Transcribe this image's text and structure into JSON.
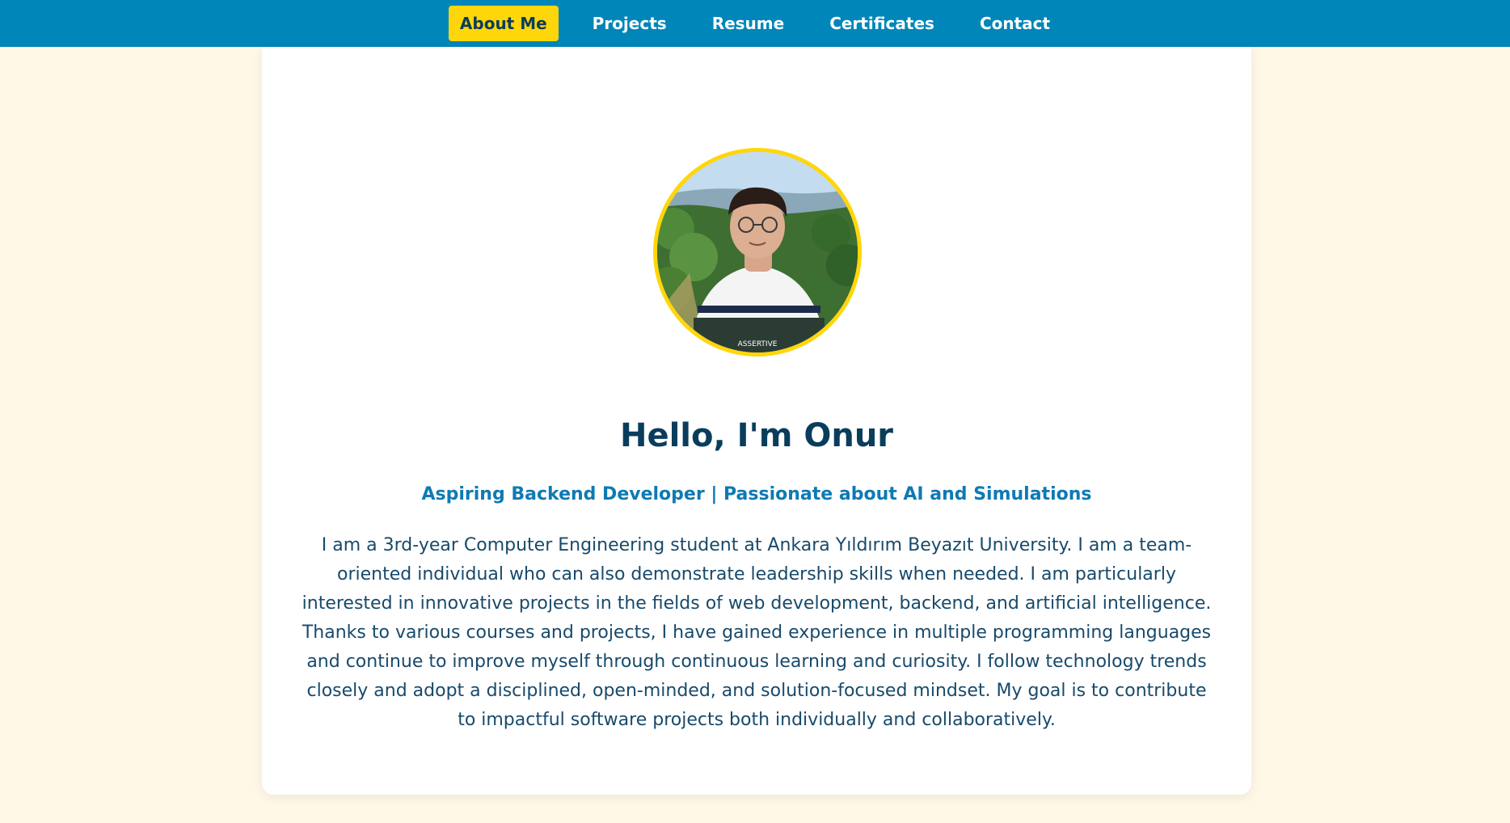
{
  "nav": {
    "items": [
      {
        "label": "About Me",
        "active": true
      },
      {
        "label": "Projects",
        "active": false
      },
      {
        "label": "Resume",
        "active": false
      },
      {
        "label": "Certificates",
        "active": false
      },
      {
        "label": "Contact",
        "active": false
      }
    ]
  },
  "profile": {
    "photo_text": "ASSERTIVE",
    "heading": "Hello, I'm Onur",
    "tagline": "Aspiring Backend Developer | Passionate about AI and Simulations",
    "bio": "I am a 3rd-year Computer Engineering student at Ankara Yıldırım Beyazıt University. I am a team-oriented individual who can also demonstrate leadership skills when needed. I am particularly interested in innovative projects in the fields of web development, backend, and artificial intelligence. Thanks to various courses and projects, I have gained experience in multiple programming languages and continue to improve myself through continuous learning and curiosity. I follow technology trends closely and adopt a disciplined, open-minded, and solution-focused mindset. My goal is to contribute to impactful software projects both individually and collaboratively."
  },
  "colors": {
    "nav_bg": "#0086b9",
    "accent": "#ffd60a",
    "page_bg": "#fff8e7",
    "heading": "#0a3d5c",
    "tagline": "#0e7ab4",
    "body_text": "#174a6b"
  }
}
